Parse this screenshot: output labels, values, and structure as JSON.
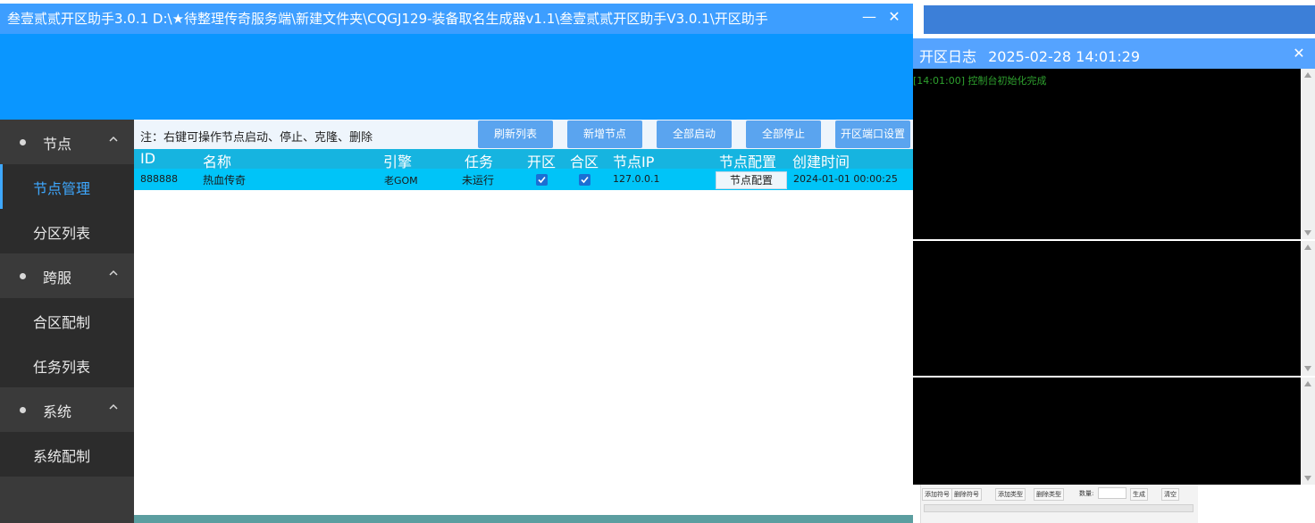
{
  "main_window": {
    "title": "叁壹贰贰开区助手3.0.1 D:\\★待整理传奇服务端\\新建文件夹\\CQGJ129-装备取名生成器v1.1\\叁壹贰贰开区助手V3.0.1\\开区助手",
    "minimize_glyph": "—",
    "close_glyph": "✕"
  },
  "sidebar": {
    "groups": [
      {
        "label": "节点",
        "items": [
          {
            "label": "节点管理",
            "active": true
          },
          {
            "label": "分区列表"
          }
        ]
      },
      {
        "label": "跨服",
        "items": [
          {
            "label": "合区配制"
          },
          {
            "label": "任务列表"
          }
        ]
      },
      {
        "label": "系统",
        "items": [
          {
            "label": "系统配制"
          }
        ]
      }
    ]
  },
  "toolbar": {
    "note": "注：右键可操作节点启动、停止、克隆、删除",
    "buttons": [
      "刷新列表",
      "新增节点",
      "全部启动",
      "全部停止",
      "开区端口设置"
    ]
  },
  "table": {
    "columns": [
      "ID",
      "名称",
      "引擎",
      "任务",
      "开区",
      "合区",
      "节点IP",
      "节点配置",
      "创建时间"
    ],
    "rows": [
      {
        "id": "888888",
        "name": "热血传奇",
        "engine": "老GOM",
        "task": "未运行",
        "open": true,
        "merge": true,
        "ip": "127.0.0.1",
        "config_button": "节点配置",
        "created": "2024-01-01 00:00:25"
      }
    ]
  },
  "log_window": {
    "title": "开区日志",
    "datetime": "2025-02-28 14:01:29",
    "close_glyph": "✕",
    "lines": [
      "[14:01:00] 控制台初始化完成"
    ]
  },
  "background_window": {
    "buttons": [
      "添加符号",
      "删除符号",
      "添加类型",
      "删除类型",
      "生成",
      "清空"
    ],
    "count_label": "数量:"
  },
  "colors": {
    "title_bar": "#3d9eff",
    "banner": "#0a96ff",
    "sidebar": "#3a3a3a",
    "accent": "#3ea8ff",
    "table_header": "#16b4e0",
    "table_row": "#00c4f8"
  }
}
